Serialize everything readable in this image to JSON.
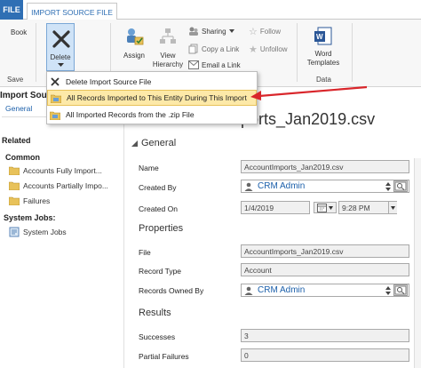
{
  "tabs": {
    "file": "FILE",
    "import": "IMPORT SOURCE FILE"
  },
  "ribbon": {
    "book": "Book",
    "save": "Save",
    "delete": "Delete",
    "assign": "Assign",
    "view_hierarchy": [
      "View",
      "Hierarchy"
    ],
    "sharing": "Sharing",
    "copy_link": "Copy a Link",
    "email_link": "Email a Link",
    "follow": "Follow",
    "unfollow": "Unfollow",
    "word_templates": [
      "Word",
      "Templates"
    ],
    "data": "Data",
    "word_icon_text": "W"
  },
  "dropdown": {
    "items": [
      "Delete Import Source File",
      "All Records Imported to This Entity During This Import",
      "All Imported Records from the .zip File"
    ]
  },
  "header": {
    "entity_partial": "Import Sour",
    "general_link": "General",
    "title": "AccountImports_Jan2019.csv"
  },
  "leftnav": {
    "related": "Related",
    "common": "Common",
    "items": [
      "Accounts Fully Import...",
      "Accounts Partially Impo...",
      "Failures"
    ],
    "system_jobs_head": "System Jobs:",
    "system_jobs": "System Jobs"
  },
  "form": {
    "general_section": "General",
    "name_label": "Name",
    "name_value": "AccountImports_Jan2019.csv",
    "created_by_label": "Created By",
    "created_by_value": "CRM Admin",
    "created_on_label": "Created On",
    "created_on_date": "1/4/2019",
    "created_on_time": "9:28 PM",
    "properties_section": "Properties",
    "file_label": "File",
    "file_value": "AccountImports_Jan2019.csv",
    "record_type_label": "Record Type",
    "record_type_value": "Account",
    "owned_by_label": "Records Owned By",
    "owned_by_value": "CRM Admin",
    "results_section": "Results",
    "successes_label": "Successes",
    "successes_value": "3",
    "partial_label": "Partial Failures",
    "partial_value": "0"
  },
  "colors": {
    "accent": "#2f6fb4",
    "arrow": "#d9262b",
    "highlight": "#fde9a8"
  }
}
